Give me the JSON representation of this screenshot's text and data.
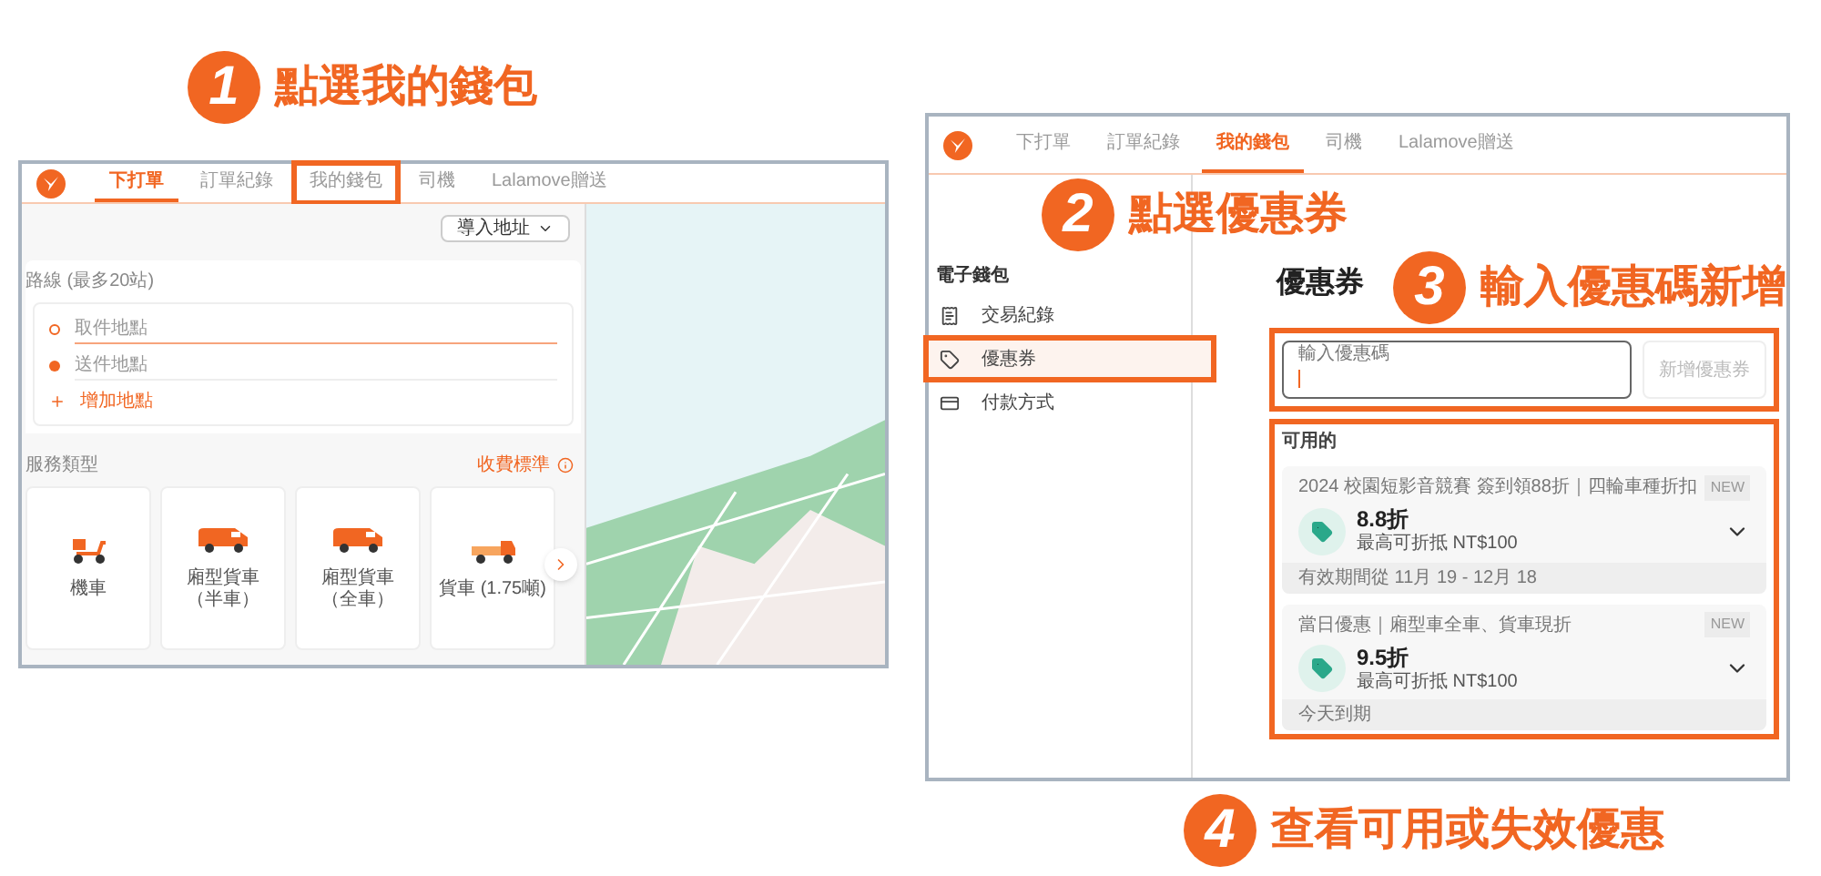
{
  "steps": [
    {
      "number": "1",
      "label": "點選我的錢包"
    },
    {
      "number": "2",
      "label": "點選優惠券"
    },
    {
      "number": "3",
      "label": "輸入優惠碼新增"
    },
    {
      "number": "4",
      "label": "查看可用或失效優惠"
    }
  ],
  "left_screen": {
    "nav_tabs": [
      {
        "label": "下打單",
        "selected": true,
        "highlighted": false
      },
      {
        "label": "訂單紀錄",
        "selected": false,
        "highlighted": false
      },
      {
        "label": "我的錢包",
        "selected": false,
        "highlighted": true
      },
      {
        "label": "司機",
        "selected": false,
        "highlighted": false
      },
      {
        "label": "Lalamove贈送",
        "selected": false,
        "highlighted": false
      }
    ],
    "import_button": "導入地址",
    "route_label": "路線 (最多20站)",
    "stops": [
      {
        "kind": "pickup",
        "placeholder": "取件地點"
      },
      {
        "kind": "dropoff",
        "placeholder": "送件地點"
      }
    ],
    "add_stop": "增加地點",
    "service_label": "服務類型",
    "pricing_link": "收費標準",
    "vehicles": [
      {
        "kind": "scooter",
        "name": "機車"
      },
      {
        "kind": "van",
        "name": "廂型貨車（半車）"
      },
      {
        "kind": "van",
        "name": "廂型貨車（全車）"
      },
      {
        "kind": "truck",
        "name": "貨車 (1.75噸)"
      }
    ]
  },
  "right_screen": {
    "nav_tabs": [
      {
        "label": "下打單",
        "selected": false
      },
      {
        "label": "訂單紀錄",
        "selected": false
      },
      {
        "label": "我的錢包",
        "selected": true
      },
      {
        "label": "司機",
        "selected": false
      },
      {
        "label": "Lalamove贈送",
        "selected": false
      }
    ],
    "sidebar": {
      "heading": "電子錢包",
      "items": [
        {
          "kind": "transactions",
          "label": "交易紀錄",
          "selected": false,
          "highlighted": false
        },
        {
          "kind": "coupons",
          "label": "優惠券",
          "selected": true,
          "highlighted": true
        },
        {
          "kind": "payment",
          "label": "付款方式",
          "selected": false,
          "highlighted": false
        }
      ]
    },
    "title": "優惠券",
    "code_field": {
      "label": "輸入優惠碼"
    },
    "add_button": {
      "label": "新增優惠券",
      "disabled": true
    },
    "section_label": "可用的",
    "coupons": [
      {
        "title": "2024 校園短影音競賽 簽到領88折｜四輪車種折扣",
        "badge": "NEW",
        "discount": "8.8折",
        "cap": "最高可折抵 NT$100",
        "validity": "有效期間從 11月 19 - 12月 18"
      },
      {
        "title": "當日優惠｜廂型車全車、貨車現折",
        "badge": "NEW",
        "discount": "9.5折",
        "cap": "最高可折抵 NT$100",
        "validity": "今天到期"
      }
    ]
  }
}
